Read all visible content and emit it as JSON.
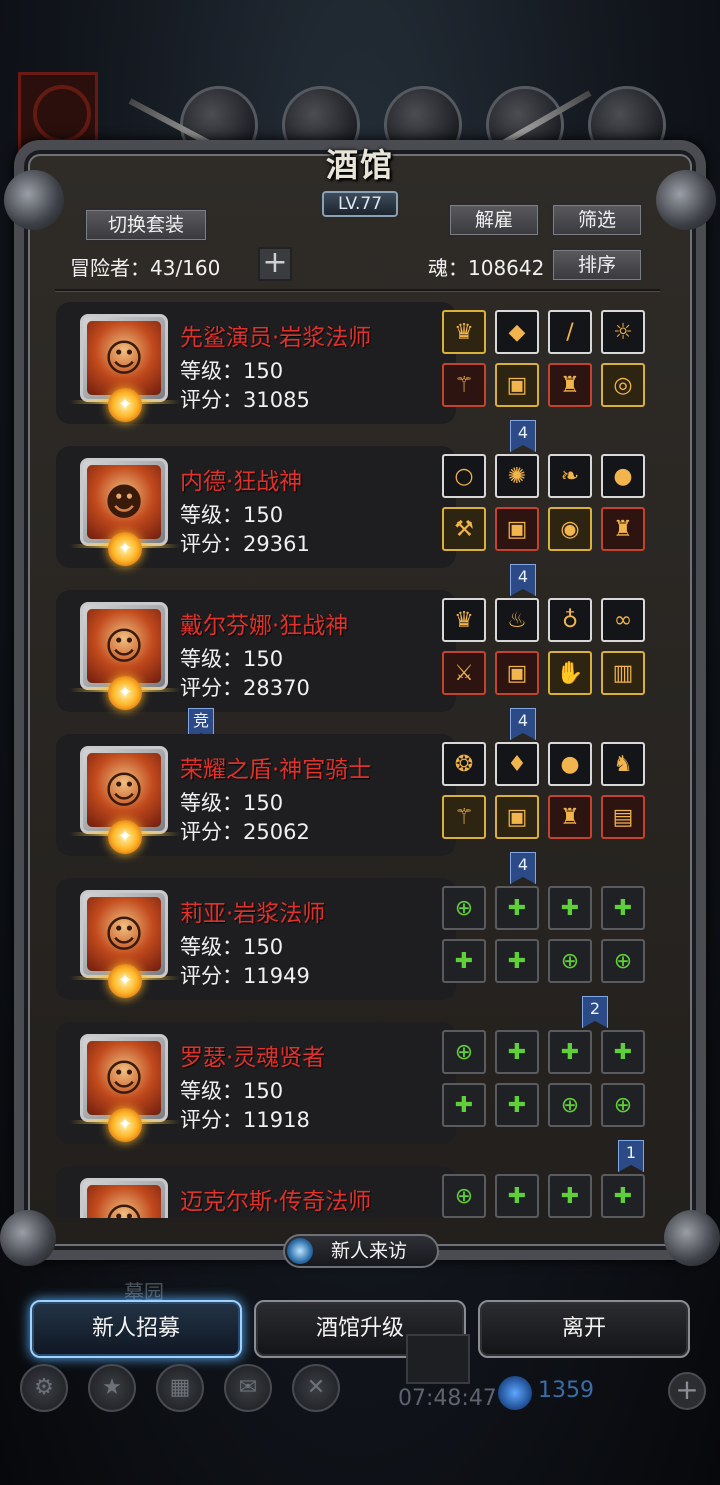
{
  "panel": {
    "title": "酒馆",
    "level": "LV.77",
    "switch_outfit": "切换套装",
    "dismiss": "解雇",
    "filter": "筛选",
    "sort": "排序",
    "adventurers_label": "冒险者：43/160",
    "soul_label": "魂：108642",
    "add_icon": "plus-icon"
  },
  "heroes": [
    {
      "name": "先鲨演员·岩浆法师",
      "level": "等级：150",
      "score": "评分：31085",
      "tag": "4",
      "slots": [
        "gold",
        "white",
        "white",
        "white",
        "red",
        "gold",
        "red",
        "gold"
      ]
    },
    {
      "name": "内德·狂战神",
      "level": "等级：150",
      "score": "评分：29361",
      "tag": "4",
      "slots": [
        "white",
        "white",
        "white",
        "white",
        "gold",
        "red",
        "gold",
        "red"
      ]
    },
    {
      "name": "戴尔芬娜·狂战神",
      "level": "等级：150",
      "score": "评分：28370",
      "tag": "4",
      "tag2": "竞",
      "slots": [
        "white",
        "white",
        "white",
        "white",
        "red",
        "red",
        "gold",
        "gold"
      ]
    },
    {
      "name": "荣耀之盾·神官骑士",
      "level": "等级：150",
      "score": "评分：25062",
      "tag": "4",
      "slots": [
        "white",
        "white",
        "white",
        "white",
        "gold",
        "white",
        "red",
        "red"
      ]
    },
    {
      "name": "莉亚·岩浆法师",
      "level": "等级：150",
      "score": "评分：11949",
      "tag": "2",
      "slots": [
        "empty",
        "empty",
        "empty",
        "empty",
        "empty",
        "empty",
        "empty",
        "empty"
      ]
    },
    {
      "name": "罗瑟·灵魂贤者",
      "level": "等级：150",
      "score": "评分：11918",
      "tag": "1",
      "slots": [
        "empty",
        "empty",
        "empty",
        "empty",
        "empty",
        "empty",
        "empty",
        "empty"
      ]
    },
    {
      "name": "迈克尔斯·传奇法师",
      "level": "",
      "score": "",
      "slots": [
        "empty",
        "empty",
        "empty",
        "empty"
      ]
    }
  ],
  "visit_label": "新人来访",
  "graveyard": "墓园",
  "bottom_buttons": [
    "新人招募",
    "酒馆升级",
    "离开"
  ],
  "hud": {
    "time": "07:48:47",
    "gems": "1359"
  }
}
